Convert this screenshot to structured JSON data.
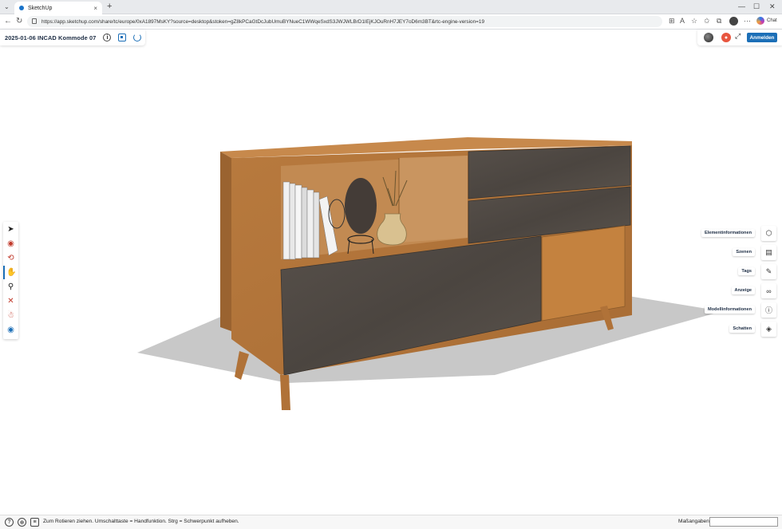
{
  "browser": {
    "tab_title": "SketchUp",
    "url": "https://app.sketchup.com/share/tc/europe/0xA1897MsKY?source=desktop&stoken=gZ8kPCaGtDcJubUmuBYNueC1WWqeSxdS3JWJWLBrD1IEjKJOuRnH7JEY7oD6m3BT&rtc-engine-version=19",
    "chat_label": "Chat"
  },
  "header": {
    "model_title": "2025-01-06 INCAD Kommode 07",
    "info_symbol": "i",
    "login_label": "Anmelden"
  },
  "panels": [
    {
      "label": "Elementinformationen",
      "icon": "cube-info-icon"
    },
    {
      "label": "Szenen",
      "icon": "scenes-icon"
    },
    {
      "label": "Tags",
      "icon": "tag-icon"
    },
    {
      "label": "Anzeige",
      "icon": "glasses-icon"
    },
    {
      "label": "Modellinformationen",
      "icon": "info-icon"
    },
    {
      "label": "Schatten",
      "icon": "shadow-icon"
    }
  ],
  "tools": [
    "select-tool-icon",
    "paint-tool-icon",
    "orbit-tool-icon",
    "pan-tool-icon",
    "zoom-tool-icon",
    "zoom-extents-icon",
    "walk-tool-icon",
    "xray-eye-icon"
  ],
  "status": {
    "hint": "Zum Rotieren ziehen. Umschalttaste = Handfunktion. Strg = Schwerpunkt aufheben.",
    "measure_label": "Maßangaben",
    "measure_value": ""
  },
  "colors": {
    "accent": "#1c6fb7",
    "wood": "#b77a3e",
    "dark_panel": "#4f4a44"
  }
}
